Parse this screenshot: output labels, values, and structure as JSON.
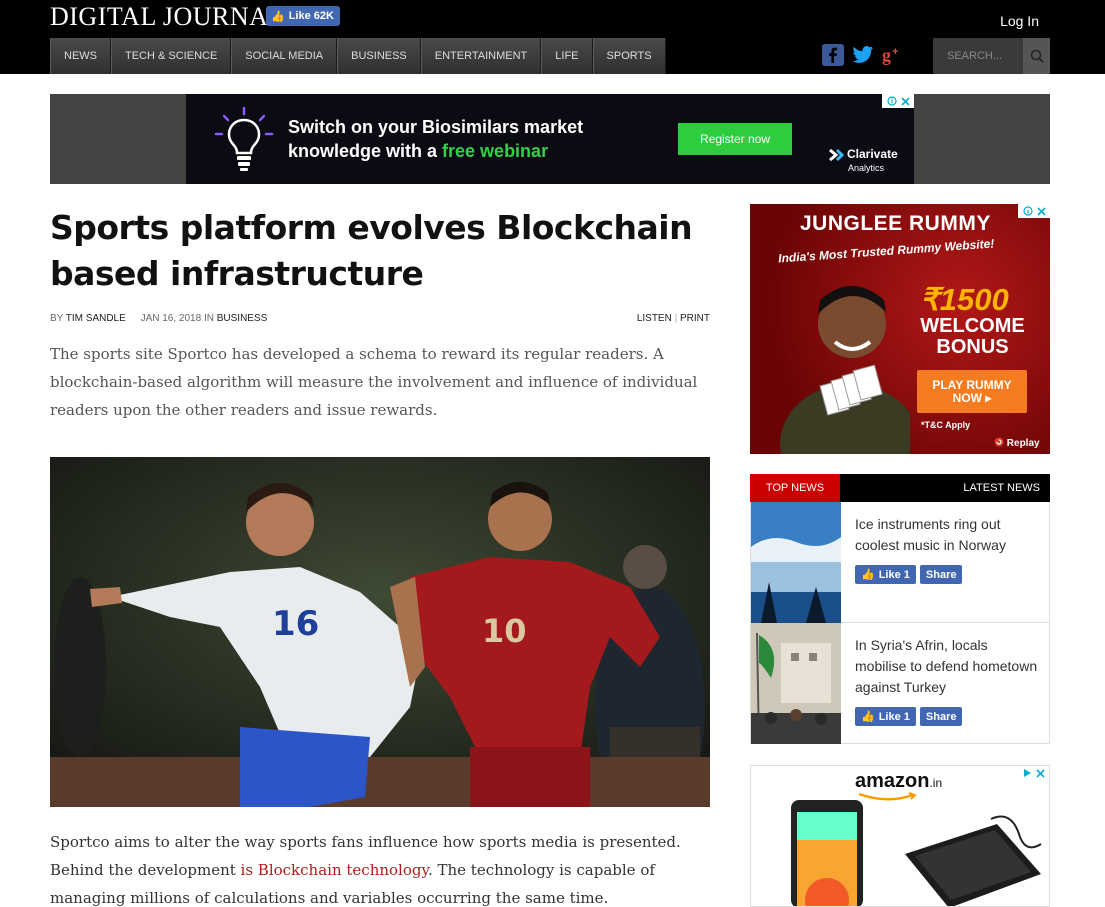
{
  "header": {
    "logo": "DIGITAL JOURNAL",
    "fb_like": "Like 62K",
    "login": "Log In",
    "search_placeholder": "SEARCH...",
    "nav": [
      "NEWS",
      "TECH & SCIENCE",
      "SOCIAL MEDIA",
      "BUSINESS",
      "ENTERTAINMENT",
      "LIFE",
      "SPORTS"
    ],
    "social_icons": [
      "facebook-icon",
      "twitter-icon",
      "google-plus-icon"
    ]
  },
  "banner_ad": {
    "line1": "Switch on your Biosimilars market",
    "line2_prefix": "knowledge with a ",
    "line2_highlight": "free webinar",
    "cta": "Register now",
    "brand": "Clarivate",
    "brand_sub": "Analytics",
    "accent": "#2fcc3d"
  },
  "article": {
    "title": "Sports platform evolves Blockchain based infrastructure",
    "by": "BY",
    "author": "TIM SANDLE",
    "date": "JAN 16, 2018",
    "in": "IN",
    "category": "BUSINESS",
    "listen": "LISTEN",
    "separator": "|",
    "print": "PRINT",
    "lead": "The sports site Sportco has developed a schema to reward its regular readers. A blockchain-based algorithm will measure the involvement and influence of individual readers upon the other readers and issue rewards.",
    "body_part1": "Sportco aims to alter the way sports fans influence how sports media is presented. Behind the development ",
    "body_link": "is Blockchain technology",
    "body_part2": ". The technology is capable of managing millions of calculations and variables occurring the same time.",
    "photo_jersey_left": "16",
    "photo_jersey_right": "10"
  },
  "rummy_ad": {
    "brand": "JUNGLEE RUMMY",
    "tagline": "India's Most Trusted Rummy Website!",
    "amount": "₹1500",
    "welcome": "WELCOME BONUS",
    "cta": "PLAY RUMMY NOW ▸",
    "tnc": "*T&C Apply",
    "replay": "Replay"
  },
  "news_widget": {
    "tab_top": "TOP NEWS",
    "tab_latest": "LATEST NEWS",
    "items": [
      {
        "title": "Ice instruments ring out coolest music in Norway",
        "like": "Like 1",
        "share": "Share"
      },
      {
        "title": "In Syria's Afrin, locals mobilise to defend hometown against Turkey",
        "like": "Like 1",
        "share": "Share"
      }
    ]
  },
  "amazon_ad": {
    "logo": "amazon",
    "suffix": ".in"
  }
}
